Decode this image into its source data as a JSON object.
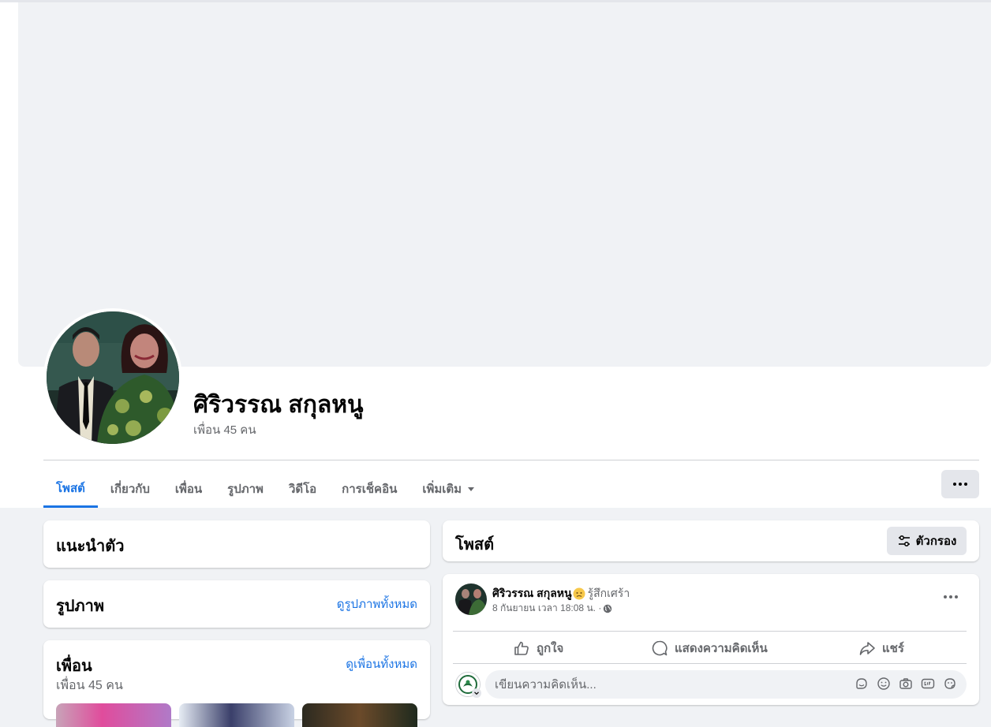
{
  "profile": {
    "name": "ศิริวรรณ สกุลหนู",
    "friend_count": "เพื่อน 45 คน"
  },
  "tabs": [
    {
      "label": "โพสต์",
      "active": true
    },
    {
      "label": "เกี่ยวกับ"
    },
    {
      "label": "เพื่อน"
    },
    {
      "label": "รูปภาพ"
    },
    {
      "label": "วิดีโอ"
    },
    {
      "label": "การเช็คอิน"
    },
    {
      "label": "เพิ่มเติม"
    }
  ],
  "intro": {
    "title": "แนะนำตัว"
  },
  "photos": {
    "title": "รูปภาพ",
    "link": "ดูรูปภาพทั้งหมด"
  },
  "friends": {
    "title": "เพื่อน",
    "link": "ดูเพื่อนทั้งหมด",
    "count": "เพื่อน 45 คน"
  },
  "posts": {
    "title": "โพสต์",
    "filter_label": "ตัวกรอง"
  },
  "post": {
    "author": "ศิริวรรณ สกุลหนู",
    "feeling": "รู้สึกเศร้า",
    "timestamp": "8 กันยายน เวลา 18:08 น. ·",
    "actions": {
      "like": "ถูกใจ",
      "comment": "แสดงความคิดเห็น",
      "share": "แชร์"
    },
    "comment_placeholder": "เขียนความคิดเห็น..."
  },
  "colors": {
    "accent": "#1b74e4",
    "background": "#f0f2f5",
    "secondary_text": "#65676b",
    "button_gray": "#e4e6eb"
  },
  "icons": [
    "filter-icon",
    "like-icon",
    "comment-icon",
    "share-icon",
    "globe-icon",
    "sticker-icon",
    "emoji-icon",
    "camera-icon",
    "gif-icon",
    "avatar-sticker-icon",
    "sad-emoji-icon",
    "more-icon"
  ]
}
